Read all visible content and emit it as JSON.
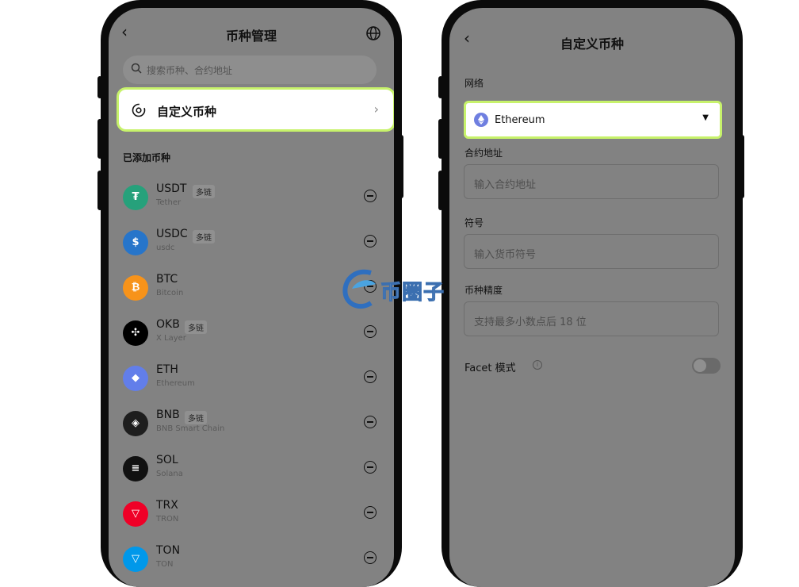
{
  "left_screen": {
    "title": "币种管理",
    "search_placeholder": "搜索币种、合约地址",
    "custom_token_label": "自定义币种",
    "section_title": "已添加币种",
    "coins": [
      {
        "symbol": "USDT",
        "badge": "多链",
        "name": "Tether",
        "color": "#26a17b",
        "glyph": "₮"
      },
      {
        "symbol": "USDC",
        "badge": "多链",
        "name": "usdc",
        "color": "#2775ca",
        "glyph": "$"
      },
      {
        "symbol": "BTC",
        "badge": "",
        "name": "Bitcoin",
        "color": "#f7931a",
        "glyph": "₿"
      },
      {
        "symbol": "OKB",
        "badge": "多链",
        "name": "X Layer",
        "color": "#000000",
        "glyph": "✣"
      },
      {
        "symbol": "ETH",
        "badge": "",
        "name": "Ethereum",
        "color": "#627eea",
        "glyph": "◆"
      },
      {
        "symbol": "BNB",
        "badge": "多链",
        "name": "BNB Smart Chain",
        "color": "#1e1e1e",
        "glyph": "◈"
      },
      {
        "symbol": "SOL",
        "badge": "",
        "name": "Solana",
        "color": "#111111",
        "glyph": "≡"
      },
      {
        "symbol": "TRX",
        "badge": "",
        "name": "TRON",
        "color": "#ef0027",
        "glyph": "▽"
      },
      {
        "symbol": "TON",
        "badge": "",
        "name": "TON",
        "color": "#0098ea",
        "glyph": "▽"
      }
    ]
  },
  "right_screen": {
    "title": "自定义币种",
    "network_label": "网络",
    "network_value": "Ethereum",
    "contract_label": "合约地址",
    "contract_placeholder": "输入合约地址",
    "symbol_label": "符号",
    "symbol_placeholder": "输入货币符号",
    "precision_label": "币种精度",
    "precision_placeholder": "支持最多小数点后 18 位",
    "facet_label": "Facet 模式",
    "facet_enabled": false
  },
  "watermark": {
    "text": "币圈子"
  },
  "colors": {
    "highlight": "#c7f26b",
    "overlay": "#828282"
  }
}
